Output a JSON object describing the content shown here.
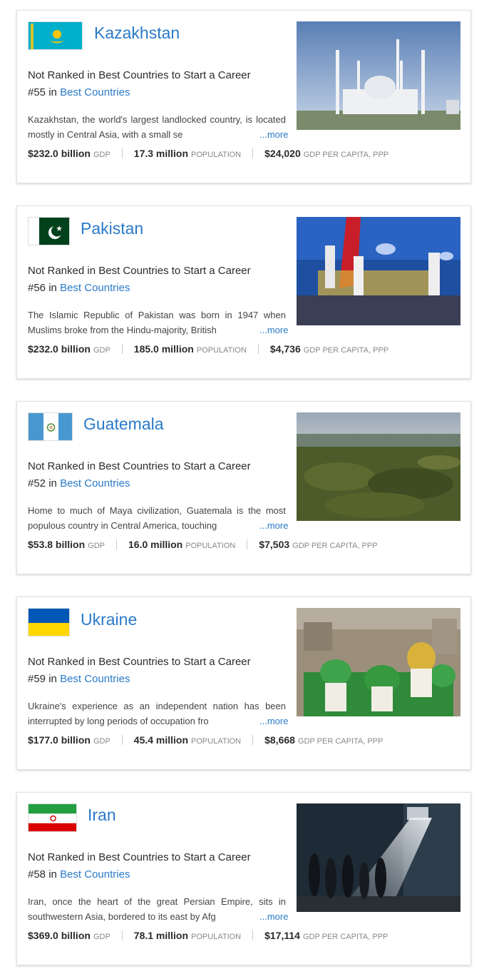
{
  "cards": [
    {
      "name": "Kazakhstan",
      "rank_text": "Not Ranked in Best Countries to Start a Career",
      "overall_rank": "#55",
      "in_word": "in",
      "overall_link": "Best Countries",
      "description": "Kazakhstan, the world's largest landlocked country, is located mostly in Central Asia, with a small se",
      "more": "...more",
      "gdp": "$232.0 billion",
      "gdp_label": "GDP",
      "population": "17.3 million",
      "population_label": "POPULATION",
      "gdp_pc": "$24,020",
      "gdp_pc_label": "GDP PER CAPITA, PPP"
    },
    {
      "name": "Pakistan",
      "rank_text": "Not Ranked in Best Countries to Start a Career",
      "overall_rank": "#56",
      "in_word": "in",
      "overall_link": "Best Countries",
      "description": "The Islamic Republic of Pakistan was born in 1947 when Muslims broke from the Hindu-majority, British",
      "more": "...more",
      "gdp": "$232.0 billion",
      "gdp_label": "GDP",
      "population": "185.0 million",
      "population_label": "POPULATION",
      "gdp_pc": "$4,736",
      "gdp_pc_label": "GDP PER CAPITA, PPP"
    },
    {
      "name": "Guatemala",
      "rank_text": "Not Ranked in Best Countries to Start a Career",
      "overall_rank": "#52",
      "in_word": "in",
      "overall_link": "Best Countries",
      "description": "Home to much of Maya civilization, Guatemala is the most populous country in Central America, touching",
      "more": "...more",
      "gdp": "$53.8 billion",
      "gdp_label": "GDP",
      "population": "16.0 million",
      "population_label": "POPULATION",
      "gdp_pc": "$7,503",
      "gdp_pc_label": "GDP PER CAPITA, PPP"
    },
    {
      "name": "Ukraine",
      "rank_text": "Not Ranked in Best Countries to Start a Career",
      "overall_rank": "#59",
      "in_word": "in",
      "overall_link": "Best Countries",
      "description": "Ukraine's experience as an independent nation has been interrupted by long periods of occupation fro",
      "more": "...more",
      "gdp": "$177.0 billion",
      "gdp_label": "GDP",
      "population": "45.4 million",
      "population_label": "POPULATION",
      "gdp_pc": "$8,668",
      "gdp_pc_label": "GDP PER CAPITA, PPP"
    },
    {
      "name": "Iran",
      "rank_text": "Not Ranked in Best Countries to Start a Career",
      "overall_rank": "#58",
      "in_word": "in",
      "overall_link": "Best Countries",
      "description": "Iran, once the heart of the great Persian Empire, sits in southwestern Asia, bordered to its east by Afg",
      "more": "...more",
      "gdp": "$369.0 billion",
      "gdp_label": "GDP",
      "population": "78.1 million",
      "population_label": "POPULATION",
      "gdp_pc": "$17,114",
      "gdp_pc_label": "GDP PER CAPITA, PPP"
    }
  ],
  "colors": {
    "link": "#2a7ac8",
    "text": "#2b2b2b",
    "muted": "#888888"
  }
}
